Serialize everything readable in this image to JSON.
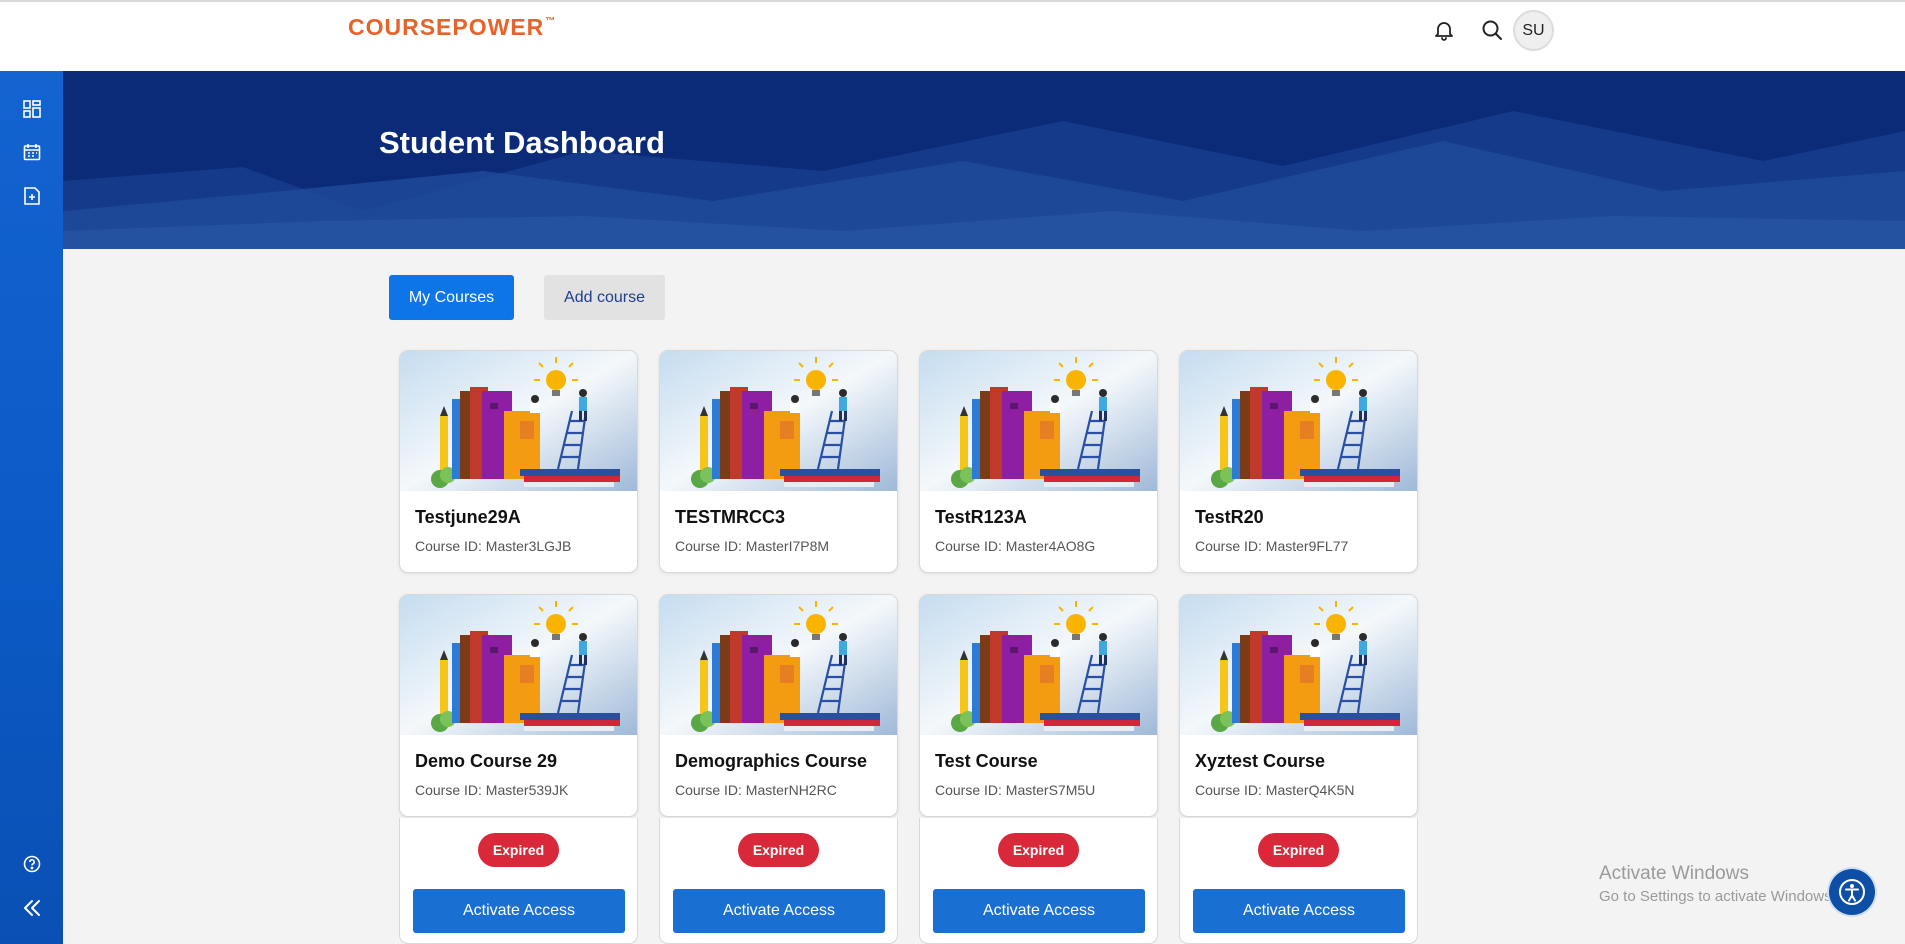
{
  "header": {
    "logo": "COURSEPOWER",
    "logo_tm": "™",
    "avatar_initials": "SU",
    "icons": [
      "bell-icon",
      "search-icon"
    ]
  },
  "sidebar": {
    "icons": [
      "dashboard-grid-icon",
      "calendar-icon",
      "add-document-icon",
      "help-icon",
      "collapse-icon"
    ]
  },
  "banner": {
    "title": "Student Dashboard"
  },
  "tabs": {
    "my_courses": "My Courses",
    "add_course": "Add course"
  },
  "courses": [
    {
      "title": "Testjune29A",
      "id": "Course ID: Master3LGJB"
    },
    {
      "title": "TESTMRCC3",
      "id": "Course ID: MasterI7P8M"
    },
    {
      "title": "TestR123A",
      "id": "Course ID: Master4AO8G"
    },
    {
      "title": "TestR20",
      "id": "Course ID: Master9FL77"
    },
    {
      "title": "Demo Course 29",
      "id": "Course ID: Master539JK",
      "status": "Expired",
      "action": "Activate Access"
    },
    {
      "title": "Demographics Course",
      "id": "Course ID: MasterNH2RC",
      "status": "Expired",
      "action": "Activate Access"
    },
    {
      "title": "Test Course",
      "id": "Course ID: MasterS7M5U",
      "status": "Expired",
      "action": "Activate Access"
    },
    {
      "title": "Xyztest Course",
      "id": "Course ID: MasterQ4K5N",
      "status": "Expired",
      "action": "Activate Access"
    }
  ],
  "watermark": {
    "title": "Activate Windows",
    "subtitle": "Go to Settings to activate Windows."
  },
  "colors": {
    "brand": "#e8632b",
    "primary": "#0d75e8",
    "banner": "#0a2a78",
    "expired": "#d8283a"
  }
}
